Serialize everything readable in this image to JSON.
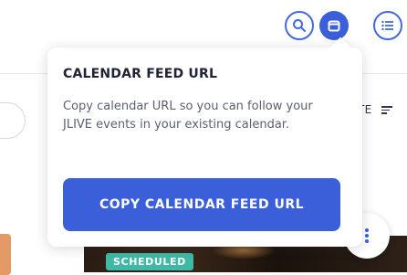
{
  "toolbar": {
    "icons": [
      "search-icon",
      "calendar-icon",
      "list-icon"
    ],
    "accent": "#3a5fd9"
  },
  "sort": {
    "partial_label": "TE"
  },
  "popover": {
    "title": "CALENDAR FEED URL",
    "description": "Copy calendar URL so you can follow your JLIVE events in your existing calendar.",
    "button_label": "COPY CALENDAR FEED URL"
  },
  "event_card": {
    "status_badge": "SCHEDULED",
    "status_color": "#3fb8a5"
  }
}
